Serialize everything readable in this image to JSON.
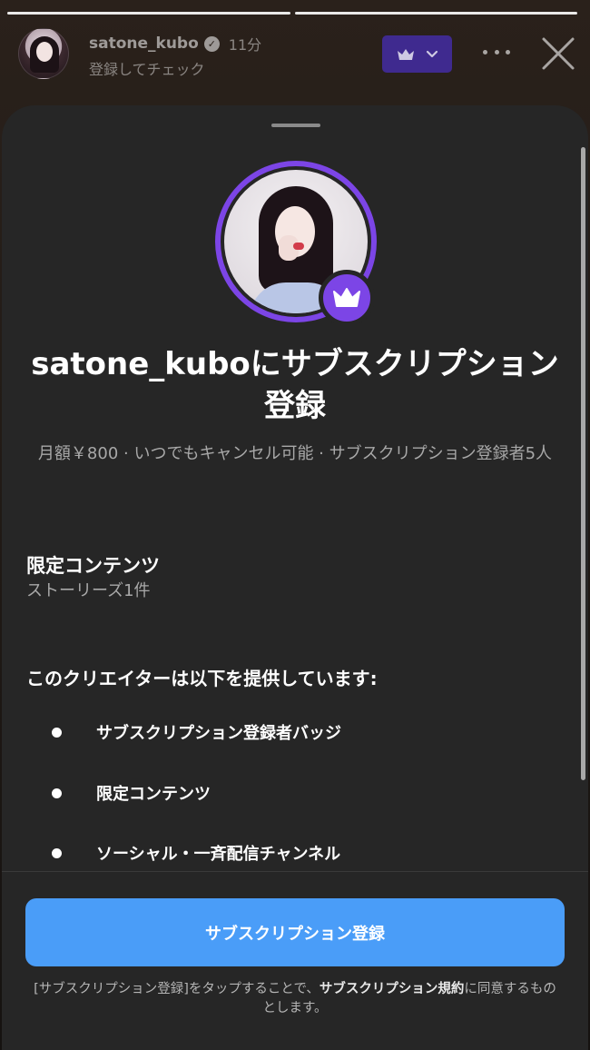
{
  "story": {
    "username": "satone_kubo",
    "time": "11分",
    "subtitle": "登録してチェック"
  },
  "sheet": {
    "title": "satone_kuboにサブスクリプション登録",
    "subtitle": "月額￥800 · いつでもキャンセル可能 · サブスクリプション登録者5人",
    "exclusive": {
      "title": "限定コンテンツ",
      "detail": "ストーリーズ1件"
    },
    "offers_title": "このクリエイターは以下を提供しています:",
    "offers": [
      "サブスクリプション登録者バッジ",
      "限定コンテンツ",
      "ソーシャル・一斉配信チャンネル"
    ],
    "cta_label": "サブスクリプション登録",
    "terms_prefix": "[サブスクリプション登録]をタップすることで、",
    "terms_link": "サブスクリプション規約",
    "terms_suffix": "に同意するものとします。"
  },
  "colors": {
    "accent_purple": "#7c45e6",
    "cta_blue": "#4a9df8",
    "sheet_bg": "#262626"
  },
  "icons": {
    "verified": "verified-badge-icon",
    "crown": "crown-icon",
    "more": "more-icon",
    "close": "close-icon",
    "chevron": "chevron-down-icon"
  }
}
